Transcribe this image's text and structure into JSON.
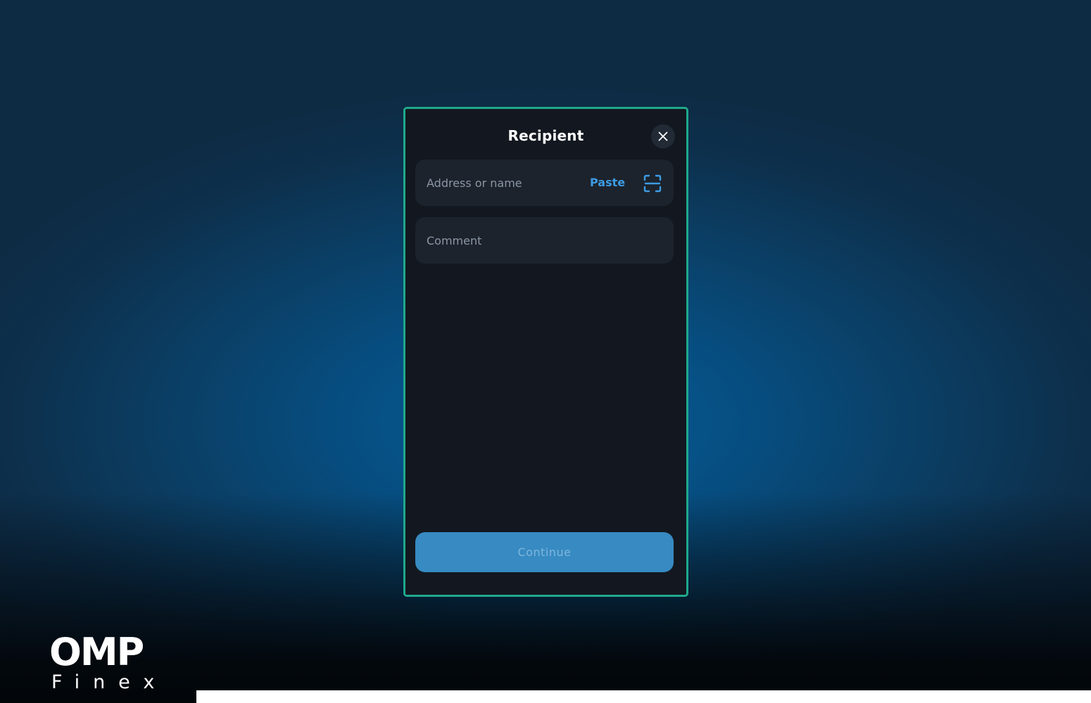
{
  "modal": {
    "title": "Recipient",
    "close_icon": "close-icon"
  },
  "address_field": {
    "placeholder": "Address or name",
    "value": "",
    "paste_label": "Paste",
    "scan_icon": "scan-qr-icon"
  },
  "comment_field": {
    "placeholder": "Comment",
    "value": ""
  },
  "continue_button": {
    "label": "Continue"
  },
  "brand": {
    "name": "OMP",
    "subtitle": "Finex"
  },
  "colors": {
    "modal_border": "#1fa98c",
    "modal_bg": "#131820",
    "field_bg": "#1c232d",
    "accent": "#3d9be3",
    "button_bg": "#378ac2"
  }
}
